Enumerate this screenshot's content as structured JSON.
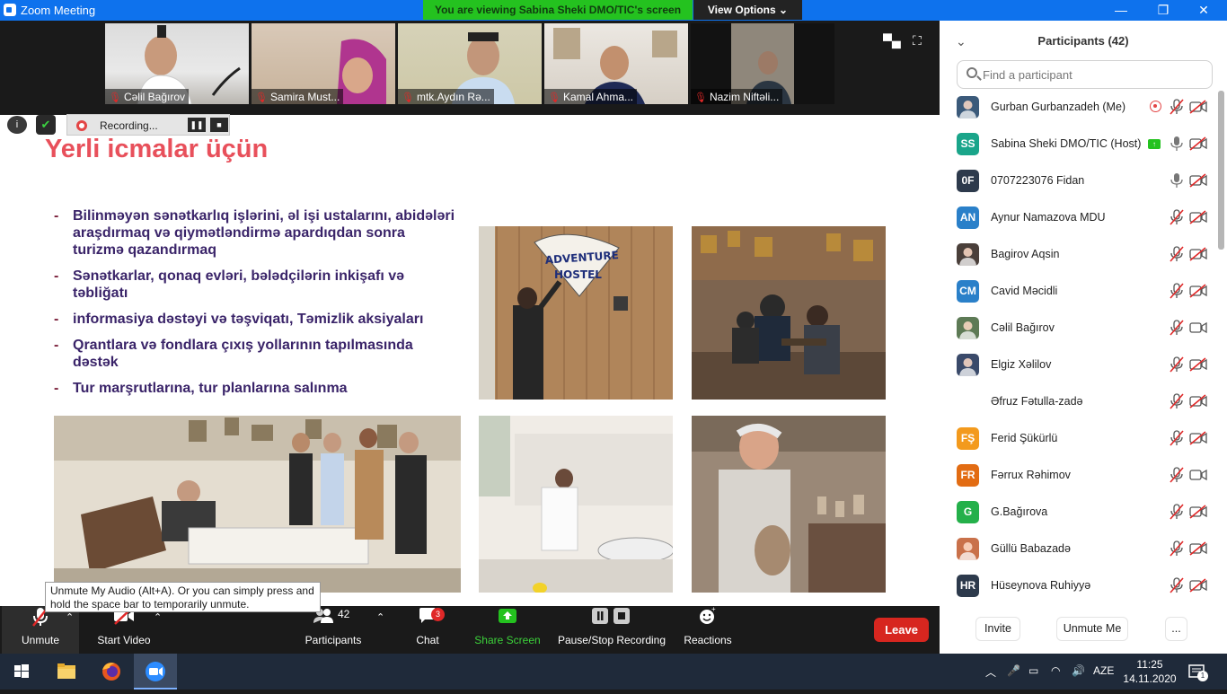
{
  "window": {
    "title": "Zoom Meeting",
    "viewing_banner": "You are viewing Sabina Sheki DMO/TIC's screen",
    "view_options": "View Options"
  },
  "video_strip": [
    {
      "name": "Cəlil Bağırov"
    },
    {
      "name": "Samira Must..."
    },
    {
      "name": "mtk.Aydın Rə..."
    },
    {
      "name": "Kamal Ahma..."
    },
    {
      "name": "Nazim Niftəli..."
    }
  ],
  "recording": {
    "label": "Recording..."
  },
  "slide": {
    "title": "Yerli icmalar üçün",
    "bullets": [
      "Bilinməyən sənətkarlıq işlərini, əl işi ustalarını, abidələri araşdırmaq və qiymətləndirmə apardıqdan sonra turizmə qazandırmaq",
      "Sənətkarlar, qonaq evləri, bələdçilərin inkişafı və təbliğatı",
      "informasiya dəstəyi və təşviqatı, Təmizlik aksiyaları",
      "Qrantlara və fondlara çıxış yollarının tapılmasında dəstək",
      "Tur marşrutlarına, tur planlarına salınma"
    ],
    "sign_line1": "ADVENTURE",
    "sign_line2": "HOSTEL"
  },
  "tooltip": "Unmute My Audio (Alt+A). Or you can simply press and hold the space bar to temporarily unmute.",
  "toolbar": {
    "unmute": "Unmute",
    "start_video": "Start Video",
    "participants": "Participants",
    "participants_count": "42",
    "chat": "Chat",
    "chat_badge": "3",
    "share_screen": "Share Screen",
    "pause_stop_recording": "Pause/Stop Recording",
    "reactions": "Reactions",
    "leave": "Leave"
  },
  "panel": {
    "title": "Participants (42)",
    "search_placeholder": "Find a participant",
    "participants": [
      {
        "initials": "",
        "name": "Gurban Gurbanzadeh (Me)",
        "color": "#3b5a7a",
        "mic": "muted",
        "cam": "off",
        "extra": "recording"
      },
      {
        "initials": "SS",
        "name": "Sabina Sheki DMO/TIC (Host)",
        "color": "#1aa58a",
        "mic": "on",
        "cam": "off",
        "extra": "sharing"
      },
      {
        "initials": "0F",
        "name": "0707223076 Fidan",
        "color": "#2d3a4c",
        "mic": "on",
        "cam": "off",
        "extra": ""
      },
      {
        "initials": "AN",
        "name": "Aynur Namazova MDU",
        "color": "#2a80c9",
        "mic": "muted",
        "cam": "off",
        "extra": ""
      },
      {
        "initials": "",
        "name": "Bagirov Aqsin",
        "color": "#4a3f3a",
        "mic": "muted",
        "cam": "off",
        "extra": ""
      },
      {
        "initials": "CM",
        "name": "Cavid Məcidli",
        "color": "#2a80c9",
        "mic": "muted",
        "cam": "off",
        "extra": ""
      },
      {
        "initials": "",
        "name": "Cəlil Bağırov",
        "color": "#5d7a55",
        "mic": "muted",
        "cam": "on",
        "extra": ""
      },
      {
        "initials": "",
        "name": "Elgiz Xəlilov",
        "color": "#3a4a6a",
        "mic": "muted",
        "cam": "off",
        "extra": ""
      },
      {
        "initials": "",
        "name": "Əfruz Fətulla-zadə",
        "color": "#ffffff",
        "mic": "muted",
        "cam": "off",
        "extra": ""
      },
      {
        "initials": "FŞ",
        "name": "Ferid Şükürlü",
        "color": "#f39a1d",
        "mic": "muted",
        "cam": "off",
        "extra": ""
      },
      {
        "initials": "FR",
        "name": "Fərrux Rəhimov",
        "color": "#e26c13",
        "mic": "muted",
        "cam": "on",
        "extra": ""
      },
      {
        "initials": "G",
        "name": "G.Bağırova",
        "color": "#24b04a",
        "mic": "muted",
        "cam": "off",
        "extra": ""
      },
      {
        "initials": "",
        "name": "Güllü Babazadə",
        "color": "#c9714a",
        "mic": "muted",
        "cam": "off",
        "extra": ""
      },
      {
        "initials": "HR",
        "name": "Hüseynova Ruhiyyə",
        "color": "#2d3a4c",
        "mic": "muted",
        "cam": "off",
        "extra": ""
      }
    ],
    "invite": "Invite",
    "unmute_me": "Unmute Me",
    "more": "..."
  },
  "taskbar": {
    "lang": "AZE",
    "time": "11:25",
    "date": "14.11.2020",
    "notif_count": "1"
  },
  "colors": {
    "zoom_blue": "#0e72ed",
    "banner_green": "#24c21f",
    "leave_red": "#d7261f",
    "slide_title": "#e8505b",
    "slide_text": "#3a2469"
  }
}
